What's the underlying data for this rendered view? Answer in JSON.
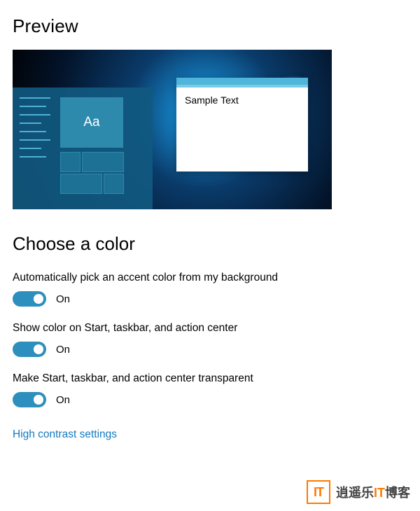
{
  "preview": {
    "title": "Preview",
    "tile_label": "Aa",
    "sample_window_text": "Sample Text"
  },
  "section": {
    "title": "Choose a color"
  },
  "settings": [
    {
      "label": "Automatically pick an accent color from my background",
      "state": "On"
    },
    {
      "label": "Show color on Start, taskbar, and action center",
      "state": "On"
    },
    {
      "label": "Make Start, taskbar, and action center transparent",
      "state": "On"
    }
  ],
  "link": {
    "high_contrast": "High contrast settings"
  },
  "watermark": {
    "badge": "IT",
    "text_pre": "逍遥乐",
    "text_it": "IT",
    "text_post": "博客"
  }
}
